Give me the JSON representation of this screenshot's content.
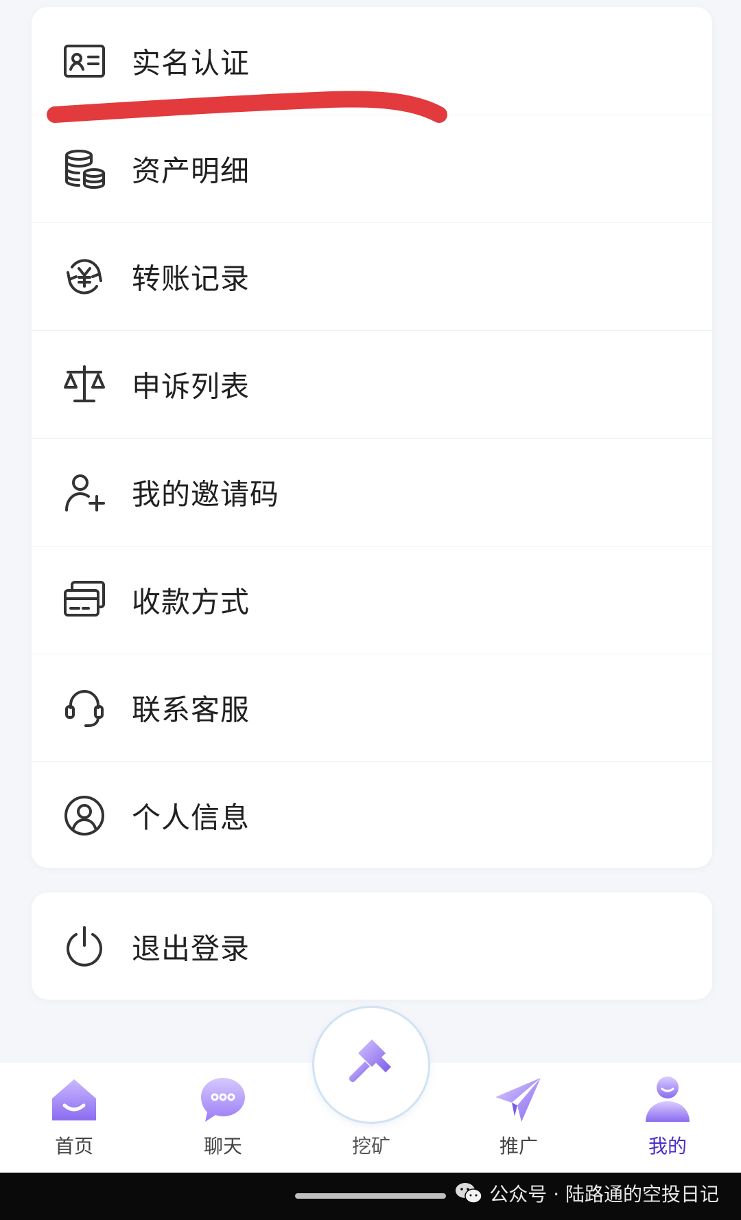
{
  "menu": {
    "items": [
      {
        "label": "实名认证",
        "icon": "id-card-icon"
      },
      {
        "label": "资产明细",
        "icon": "coins-stack-icon"
      },
      {
        "label": "转账记录",
        "icon": "yen-exchange-icon"
      },
      {
        "label": "申诉列表",
        "icon": "scale-icon"
      },
      {
        "label": "我的邀请码",
        "icon": "add-user-icon"
      },
      {
        "label": "收款方式",
        "icon": "payment-card-icon"
      },
      {
        "label": "联系客服",
        "icon": "headset-icon"
      },
      {
        "label": "个人信息",
        "icon": "user-circle-icon"
      }
    ],
    "highlight_color": "#e23a3d"
  },
  "logout": {
    "label": "退出登录",
    "icon": "power-icon"
  },
  "tabbar": {
    "tabs": [
      {
        "label": "首页",
        "icon": "home-icon"
      },
      {
        "label": "聊天",
        "icon": "chat-bubble-icon"
      },
      {
        "label": "挖矿",
        "icon": "hammer-icon"
      },
      {
        "label": "推广",
        "icon": "paper-plane-icon"
      },
      {
        "label": "我的",
        "icon": "profile-icon",
        "active": true
      }
    ],
    "accent_color": "#8b6cf0"
  },
  "watermark": {
    "text": "公众号 · 陆路通的空投日记",
    "icon": "wechat-icon"
  }
}
